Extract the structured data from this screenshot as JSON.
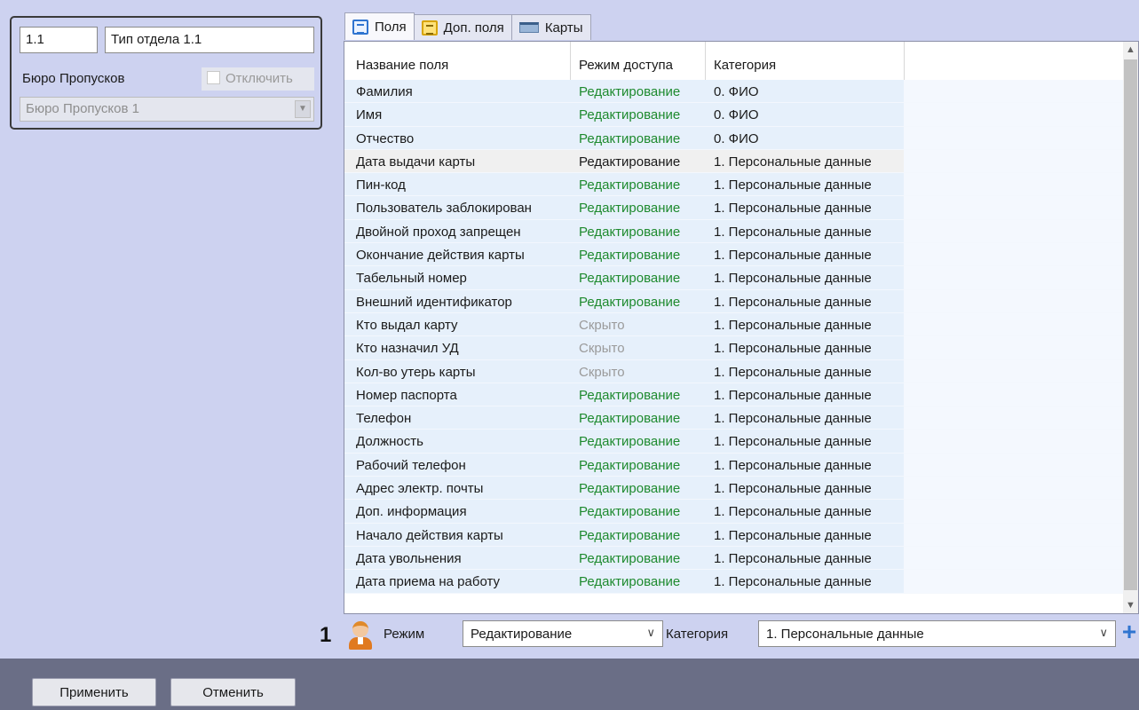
{
  "left_panel": {
    "id_value": "1.1",
    "name_value": "Тип отдела 1.1",
    "bureau_label": "Бюро Пропусков",
    "disable_label": "Отключить",
    "bureau_select_value": "Бюро Пропусков 1"
  },
  "tabs": [
    {
      "label": "Поля",
      "icon": "list-icon",
      "active": true
    },
    {
      "label": "Доп. поля",
      "icon": "extra-fields-icon",
      "active": false
    },
    {
      "label": "Карты",
      "icon": "card-icon",
      "active": false
    }
  ],
  "grid": {
    "columns": [
      "Название поля",
      "Режим доступа",
      "Категория"
    ],
    "rows": [
      {
        "name": "Фамилия",
        "mode": "Редактирование",
        "category": "0. ФИО"
      },
      {
        "name": "Имя",
        "mode": "Редактирование",
        "category": "0. ФИО"
      },
      {
        "name": "Отчество",
        "mode": "Редактирование",
        "category": "0. ФИО"
      },
      {
        "name": "Дата выдачи карты",
        "mode": "Редактирование",
        "category": "1. Персональные данные"
      },
      {
        "name": "Пин-код",
        "mode": "Редактирование",
        "category": "1. Персональные данные"
      },
      {
        "name": "Пользователь заблокирован",
        "mode": "Редактирование",
        "category": "1. Персональные данные"
      },
      {
        "name": "Двойной проход запрещен",
        "mode": "Редактирование",
        "category": "1. Персональные данные"
      },
      {
        "name": "Окончание действия карты",
        "mode": "Редактирование",
        "category": "1. Персональные данные"
      },
      {
        "name": "Табельный номер",
        "mode": "Редактирование",
        "category": "1. Персональные данные"
      },
      {
        "name": "Внешний идентификатор",
        "mode": "Редактирование",
        "category": "1. Персональные данные"
      },
      {
        "name": "Кто выдал карту",
        "mode": "Скрыто",
        "category": "1. Персональные данные"
      },
      {
        "name": "Кто назначил УД",
        "mode": "Скрыто",
        "category": "1. Персональные данные"
      },
      {
        "name": "Кол-во утерь карты",
        "mode": "Скрыто",
        "category": "1. Персональные данные"
      },
      {
        "name": "Номер паспорта",
        "mode": "Редактирование",
        "category": "1. Персональные данные"
      },
      {
        "name": "Телефон",
        "mode": "Редактирование",
        "category": "1. Персональные данные"
      },
      {
        "name": "Должность",
        "mode": "Редактирование",
        "category": "1. Персональные данные"
      },
      {
        "name": "Рабочий телефон",
        "mode": "Редактирование",
        "category": "1. Персональные данные"
      },
      {
        "name": "Адрес электр. почты",
        "mode": "Редактирование",
        "category": "1. Персональные данные"
      },
      {
        "name": "Доп. информация",
        "mode": "Редактирование",
        "category": "1. Персональные данные"
      },
      {
        "name": "Начало действия карты",
        "mode": "Редактирование",
        "category": "1. Персональные данные"
      },
      {
        "name": "Дата увольнения",
        "mode": "Редактирование",
        "category": "1. Персональные данные"
      },
      {
        "name": "Дата приема на работу",
        "mode": "Редактирование",
        "category": "1. Персональные данные"
      }
    ],
    "selected_row": 3,
    "colors": {
      "edit": "#1e8a2e",
      "hidden": "#9a9a9a"
    }
  },
  "filter": {
    "marker": "1",
    "mode_label": "Режим",
    "mode_value": "Редактирование",
    "category_label": "Категория",
    "category_value": "1. Персональные данные",
    "add_symbol": "+"
  },
  "buttons": {
    "apply": "Применить",
    "cancel": "Отменить"
  }
}
